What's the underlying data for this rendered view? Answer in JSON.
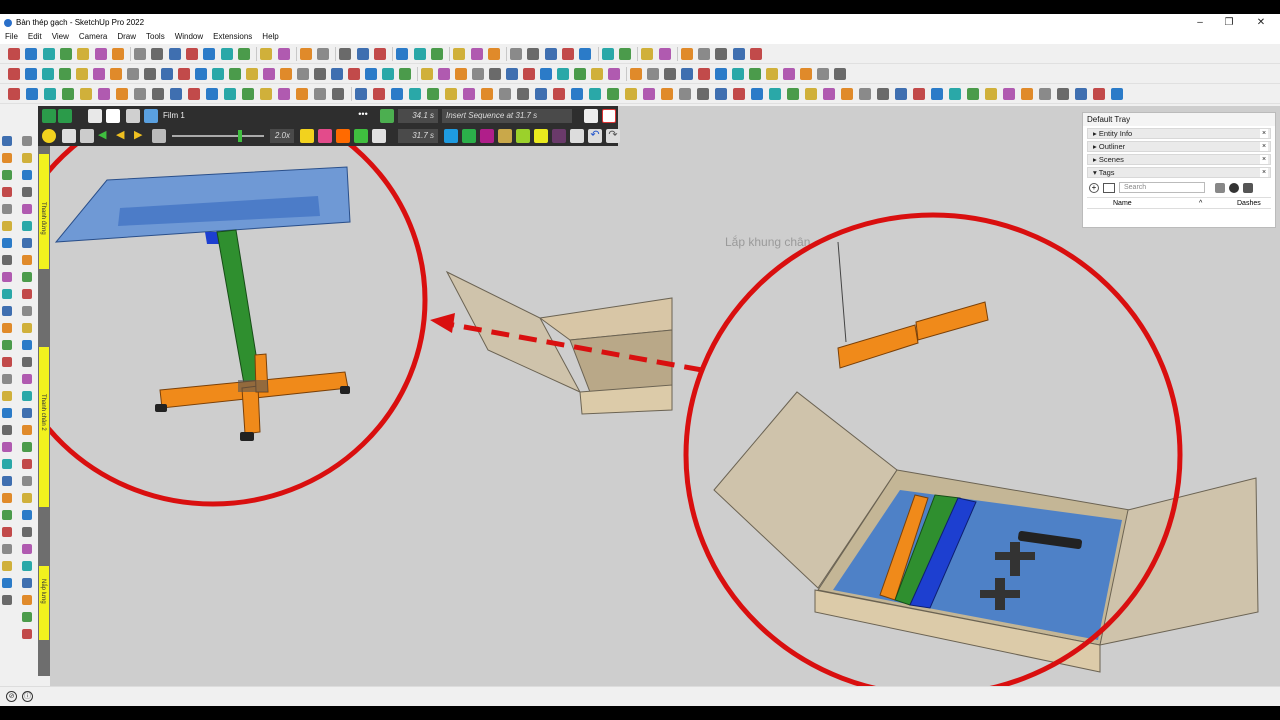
{
  "window": {
    "title": "Bàn thép gạch - SketchUp Pro 2022",
    "controls": [
      "–",
      "❐",
      "✕"
    ]
  },
  "menu": [
    "File",
    "Edit",
    "View",
    "Camera",
    "Draw",
    "Tools",
    "Window",
    "Extensions",
    "Help"
  ],
  "animation_bar": {
    "film_name": "Film 1",
    "speed": "2.0x",
    "time_total": "34.1 s",
    "time_current": "31.7 s",
    "sequence_hint": "Insert Sequence at 31.7 s"
  },
  "left_labels": {
    "section1": "Thanh đứng",
    "section2": "Thanh chân 2",
    "section3": "Nắp lưng"
  },
  "tray": {
    "title": "Default Tray",
    "sections": [
      "Entity Info",
      "Outliner",
      "Scenes",
      "Tags"
    ],
    "search_placeholder": "Search",
    "col_name": "Name",
    "col_dashes": "Dashes"
  },
  "annotation": {
    "label": "Lắp khung chân"
  },
  "colors": {
    "circle": "#d90f0f",
    "viewport": "#cecece",
    "wood": "#d8c6a6",
    "blue_panel": "#3a78d0",
    "green_bar": "#2f8f2f",
    "orange_bar": "#f08a1a"
  }
}
